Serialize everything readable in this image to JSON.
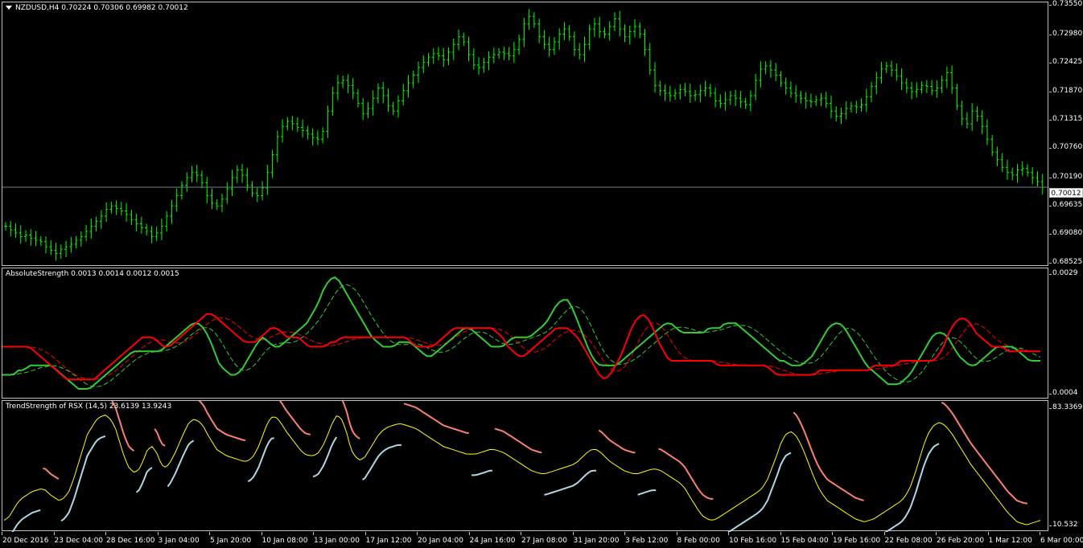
{
  "main_chart": {
    "label": "NZDUSD,H4  0.70224 0.70306 0.69982 0.70012",
    "current_price": "0.70012",
    "price_scale": [
      "0.73550",
      "0.72980",
      "0.72425",
      "0.71870",
      "0.71315",
      "0.70760",
      "0.70190",
      "0.69635",
      "0.69080",
      "0.68525"
    ],
    "candle_color": "#00ff00",
    "price_line_color": "#708090",
    "closes": [
      0.6925,
      0.6918,
      0.6912,
      0.6905,
      0.6908,
      0.6902,
      0.6898,
      0.6895,
      0.6885,
      0.6878,
      0.6872,
      0.688,
      0.6885,
      0.689,
      0.6898,
      0.6905,
      0.6915,
      0.6925,
      0.6935,
      0.6945,
      0.6958,
      0.6965,
      0.696,
      0.6955,
      0.6948,
      0.6938,
      0.693,
      0.6922,
      0.6915,
      0.6905,
      0.6912,
      0.6925,
      0.6945,
      0.6965,
      0.6985,
      0.7005,
      0.702,
      0.703,
      0.7025,
      0.701,
      0.6985,
      0.697,
      0.6965,
      0.6978,
      0.6998,
      0.702,
      0.7035,
      0.7025,
      0.7005,
      0.699,
      0.6985,
      0.7,
      0.703,
      0.7065,
      0.71,
      0.712,
      0.713,
      0.7125,
      0.7118,
      0.7112,
      0.7105,
      0.7098,
      0.7095,
      0.711,
      0.715,
      0.7185,
      0.7205,
      0.721,
      0.72,
      0.7185,
      0.7165,
      0.7145,
      0.7155,
      0.7175,
      0.7195,
      0.718,
      0.716,
      0.715,
      0.717,
      0.719,
      0.7205,
      0.722,
      0.7235,
      0.7245,
      0.7255,
      0.7262,
      0.7258,
      0.725,
      0.7265,
      0.728,
      0.7295,
      0.7285,
      0.726,
      0.724,
      0.7235,
      0.7245,
      0.7255,
      0.726,
      0.7265,
      0.7262,
      0.7258,
      0.727,
      0.729,
      0.732,
      0.7335,
      0.732,
      0.7295,
      0.728,
      0.727,
      0.7285,
      0.73,
      0.731,
      0.7295,
      0.727,
      0.726,
      0.728,
      0.731,
      0.732,
      0.7305,
      0.73,
      0.7315,
      0.733,
      0.731,
      0.7295,
      0.7305,
      0.7315,
      0.73,
      0.727,
      0.723,
      0.72,
      0.719,
      0.7185,
      0.718,
      0.7185,
      0.7192,
      0.7188,
      0.718,
      0.7182,
      0.719,
      0.7195,
      0.7185,
      0.717,
      0.7165,
      0.7172,
      0.718,
      0.7175,
      0.7168,
      0.7162,
      0.718,
      0.721,
      0.7232,
      0.7238,
      0.723,
      0.722,
      0.7205,
      0.7195,
      0.7185,
      0.718,
      0.7175,
      0.717,
      0.7168,
      0.7172,
      0.7175,
      0.7165,
      0.715,
      0.714,
      0.7145,
      0.7155,
      0.716,
      0.7158,
      0.7162,
      0.7178,
      0.7198,
      0.7215,
      0.7232,
      0.7238,
      0.723,
      0.7218,
      0.7205,
      0.7195,
      0.7188,
      0.7192,
      0.72,
      0.7198,
      0.719,
      0.7195,
      0.721,
      0.7225,
      0.7195,
      0.716,
      0.7135,
      0.7125,
      0.715,
      0.714,
      0.712,
      0.7095,
      0.707,
      0.7055,
      0.704,
      0.703,
      0.7025,
      0.7035,
      0.7038,
      0.703,
      0.702,
      0.7012,
      0.7001
    ]
  },
  "absolute_strength": {
    "label": "AbsoluteStrength 0.0013 0.0014 0.0012 0.0015",
    "scale_top": "0.0029",
    "scale_bottom": "0.0004",
    "green_color": "#32cd32",
    "red_color": "#ff0000",
    "green": [
      6,
      6,
      6,
      7,
      7,
      8,
      8,
      8,
      8,
      8,
      7,
      6,
      5,
      4,
      3,
      3,
      3,
      4,
      5,
      6,
      7,
      8,
      9,
      10,
      11,
      11,
      11,
      11,
      11,
      11,
      12,
      13,
      14,
      15,
      16,
      17,
      17,
      16,
      14,
      11,
      8,
      7,
      6,
      6,
      7,
      9,
      11,
      13,
      14,
      13,
      12,
      12,
      13,
      14,
      15,
      16,
      17,
      19,
      21,
      24,
      26,
      27,
      26,
      24,
      22,
      20,
      18,
      16,
      14,
      13,
      12,
      12,
      12,
      13,
      13,
      13,
      12,
      11,
      10,
      10,
      11,
      12,
      13,
      14,
      15,
      16,
      16,
      15,
      14,
      13,
      12,
      12,
      12,
      13,
      14,
      14,
      14,
      14,
      15,
      16,
      17,
      19,
      21,
      22,
      22,
      20,
      17,
      14,
      11,
      9,
      8,
      8,
      8,
      8,
      9,
      10,
      11,
      12,
      13,
      14,
      15,
      16,
      17,
      17,
      16,
      15,
      15,
      15,
      15,
      15,
      16,
      16,
      16,
      17,
      17,
      17,
      16,
      15,
      14,
      13,
      12,
      11,
      10,
      9,
      9,
      8,
      8,
      8,
      9,
      10,
      12,
      14,
      16,
      17,
      17,
      16,
      14,
      12,
      10,
      8,
      7,
      6,
      5,
      4,
      4,
      4,
      5,
      6,
      8,
      10,
      12,
      14,
      15,
      15,
      14,
      12,
      10,
      9,
      8,
      8,
      9,
      10,
      11,
      12,
      12,
      12,
      12,
      11,
      10,
      9,
      9,
      9
    ],
    "red": [
      12,
      12,
      12,
      12,
      12,
      12,
      11,
      10,
      9,
      8,
      7,
      6,
      5,
      5,
      5,
      5,
      5,
      5,
      6,
      7,
      8,
      9,
      10,
      11,
      12,
      13,
      14,
      14,
      14,
      13,
      12,
      12,
      13,
      14,
      15,
      16,
      17,
      18,
      19,
      19,
      18,
      17,
      16,
      15,
      14,
      13,
      13,
      13,
      14,
      15,
      16,
      16,
      15,
      14,
      14,
      14,
      13,
      12,
      12,
      12,
      12,
      13,
      13,
      14,
      14,
      14,
      14,
      14,
      14,
      14,
      14,
      14,
      14,
      14,
      14,
      14,
      13,
      12,
      12,
      12,
      12,
      13,
      14,
      15,
      16,
      16,
      16,
      16,
      16,
      16,
      16,
      16,
      15,
      14,
      12,
      11,
      10,
      10,
      11,
      12,
      13,
      14,
      15,
      16,
      16,
      16,
      15,
      14,
      12,
      10,
      8,
      6,
      5,
      6,
      8,
      10,
      13,
      16,
      18,
      19,
      18,
      16,
      13,
      11,
      9,
      9,
      9,
      9,
      9,
      9,
      9,
      9,
      9,
      8,
      8,
      8,
      8,
      8,
      8,
      8,
      8,
      8,
      8,
      7,
      6,
      6,
      6,
      6,
      6,
      6,
      6,
      6,
      7,
      7,
      7,
      7,
      7,
      7,
      7,
      7,
      7,
      7,
      8,
      8,
      8,
      8,
      8,
      9,
      9,
      9,
      9,
      9,
      9,
      9,
      10,
      12,
      15,
      17,
      18,
      18,
      17,
      15,
      14,
      13,
      12,
      12,
      12,
      11,
      11,
      11,
      11,
      11,
      11,
      11
    ]
  },
  "trend_strength": {
    "label": "TrendStrength of RSX (14,5) 23.6139 13.9243",
    "scale_top": "83.3369",
    "scale_bottom": "10.532",
    "yellow_color": "#ffff00",
    "blue_color": "#add8e6",
    "salmon_color": "#fa8072",
    "yellow": [
      13,
      15,
      20,
      25,
      28,
      30,
      32,
      33,
      34,
      33,
      30,
      28,
      26,
      28,
      32,
      40,
      50,
      60,
      70,
      75,
      80,
      82,
      83,
      80,
      75,
      65,
      55,
      48,
      45,
      46,
      52,
      60,
      62,
      58,
      50,
      48,
      52,
      58,
      65,
      72,
      78,
      80,
      79,
      76,
      70,
      65,
      60,
      58,
      56,
      55,
      54,
      53,
      52,
      53,
      56,
      62,
      70,
      78,
      82,
      81,
      77,
      72,
      68,
      64,
      60,
      57,
      56,
      56,
      58,
      63,
      70,
      78,
      83,
      80,
      72,
      60,
      55,
      53,
      55,
      60,
      65,
      70,
      73,
      75,
      76,
      77,
      77,
      76,
      75,
      74,
      72,
      70,
      68,
      66,
      64,
      62,
      61,
      60,
      59,
      58,
      57,
      57,
      57,
      58,
      59,
      60,
      60,
      59,
      58,
      56,
      54,
      52,
      50,
      48,
      46,
      45,
      44,
      44,
      45,
      46,
      47,
      48,
      49,
      50,
      52,
      55,
      58,
      60,
      60,
      58,
      55,
      52,
      50,
      48,
      46,
      45,
      44,
      44,
      45,
      46,
      47,
      47,
      46,
      44,
      42,
      40,
      38,
      35,
      30,
      25,
      20,
      16,
      14,
      13,
      14,
      16,
      18,
      20,
      22,
      24,
      26,
      28,
      30,
      32,
      35,
      40,
      48,
      56,
      65,
      70,
      72,
      70,
      65,
      58,
      50,
      42,
      35,
      30,
      26,
      24,
      22,
      20,
      18,
      16,
      14,
      13,
      12,
      13,
      14,
      16,
      18,
      20,
      22,
      24,
      26,
      30,
      36,
      45,
      55,
      65,
      72,
      76,
      78,
      77,
      74,
      70,
      65,
      60,
      55,
      50,
      46,
      42,
      38,
      34,
      30,
      26,
      22,
      18,
      15,
      12,
      11,
      10,
      11,
      12,
      13
    ],
    "blue": [
      null,
      null,
      12,
      16,
      20,
      24,
      27,
      29,
      30,
      31,
      31,
      31,
      null,
      null,
      null,
      26,
      32,
      40,
      48,
      55,
      62,
      67,
      70,
      72,
      74,
      74,
      74,
      74,
      null,
      null,
      null,
      null,
      null,
      null,
      null,
      null,
      null,
      null,
      43,
      47,
      50,
      52,
      54,
      55,
      55,
      55,
      55,
      null,
      null,
      null,
      null,
      null,
      null,
      null,
      null,
      48,
      55,
      62,
      66,
      68,
      69,
      69,
      69,
      69,
      null,
      null,
      null,
      null,
      null,
      null,
      null,
      null,
      null,
      44,
      52,
      60,
      66,
      70,
      72,
      72,
      72,
      72,
      null,
      null,
      null,
      null,
      null,
      null,
      null,
      null,
      null,
      null,
      null,
      null,
      null,
      null,
      null,
      null,
      null,
      null,
      null,
      null,
      null,
      48,
      52,
      56,
      60,
      61,
      62,
      62,
      62,
      null,
      null,
      null,
      null,
      null,
      null,
      null,
      null,
      null,
      null,
      null,
      null,
      null,
      null,
      null,
      null,
      null,
      null,
      null,
      null,
      null,
      null,
      52,
      53,
      53,
      53,
      null,
      null,
      null,
      null,
      null,
      null,
      null,
      null,
      null,
      null,
      null,
      null,
      null,
      null,
      null,
      null,
      null,
      null,
      17,
      22,
      26,
      27,
      27,
      27,
      27,
      27,
      null,
      null,
      null,
      null,
      null,
      null,
      null,
      null,
      null,
      45,
      55,
      62,
      66,
      68,
      null,
      null,
      null,
      null,
      null,
      null,
      null,
      null,
      null,
      null,
      null,
      null,
      null,
      null,
      null,
      null,
      null,
      null,
      20,
      30,
      42,
      52,
      58,
      60,
      60,
      null,
      null,
      null,
      null,
      null,
      null,
      null,
      null,
      null,
      null,
      null,
      null,
      null,
      null,
      null,
      null,
      null,
      null,
      null,
      null
    ],
    "salmon": [
      20,
      20,
      null,
      null,
      null,
      null,
      null,
      null,
      null,
      null,
      null,
      null,
      35,
      35,
      35,
      null,
      null,
      null,
      null,
      null,
      null,
      null,
      null,
      null,
      null,
      null,
      null,
      null,
      null,
      null,
      null,
      null,
      null,
      null,
      null,
      null,
      null,
      null,
      null,
      null,
      null,
      null,
      null,
      null,
      null,
      null,
      null,
      null,
      null,
      null,
      null,
      null,
      null,
      null,
      null,
      null,
      null,
      null,
      null,
      null,
      null,
      null,
      null,
      null,
      null,
      null,
      null,
      null,
      null,
      null,
      null,
      null,
      null,
      null,
      null,
      null,
      null,
      null,
      null,
      null,
      null,
      null,
      null,
      null,
      null,
      null,
      null,
      null,
      null,
      null,
      null,
      null,
      null,
      null,
      null,
      null,
      null,
      null,
      null,
      null,
      null,
      null,
      null,
      null,
      null,
      null,
      null,
      null,
      null,
      null,
      null,
      null,
      null,
      null,
      null,
      null,
      null,
      null,
      null,
      null,
      null,
      null,
      null,
      null,
      null,
      null,
      null,
      null,
      null,
      null,
      null,
      null,
      null,
      null,
      null,
      null,
      null,
      null,
      null,
      null,
      null,
      null,
      null,
      null,
      null,
      null,
      null,
      null,
      null,
      null,
      null,
      null,
      null,
      null,
      null,
      null,
      null,
      null,
      null,
      null,
      null,
      null,
      null,
      null,
      null,
      null,
      null,
      null,
      null,
      null,
      null,
      null,
      null,
      null,
      null,
      null,
      null,
      null,
      null,
      null,
      null,
      null,
      null,
      null,
      null,
      null,
      null,
      null,
      null,
      null,
      null,
      null,
      null,
      null,
      null,
      null,
      null,
      null,
      null,
      null,
      null,
      null,
      null,
      null,
      null,
      null,
      null,
      null,
      null,
      null,
      null,
      null,
      null,
      null,
      null,
      null,
      null,
      null,
      null,
      null,
      null,
      null,
      null,
      null,
      null,
      null
    ]
  },
  "time_axis": [
    "20 Dec 2016",
    "23 Dec 04:00",
    "28 Dec 16:00",
    "3 Jan 04:00",
    "5 Jan 20:00",
    "10 Jan 08:00",
    "13 Jan 00:00",
    "17 Jan 12:00",
    "20 Jan 04:00",
    "24 Jan 16:00",
    "27 Jan 08:00",
    "31 Jan 20:00",
    "3 Feb 12:00",
    "8 Feb 00:00",
    "10 Feb 16:00",
    "15 Feb 04:00",
    "19 Feb 16:00",
    "22 Feb 08:00",
    "26 Feb 20:00",
    "1 Mar 12:00",
    "6 Mar 00:00"
  ]
}
